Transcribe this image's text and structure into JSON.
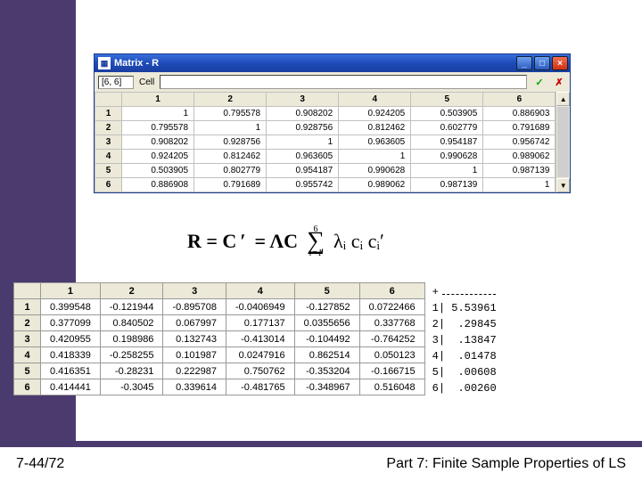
{
  "window": {
    "title": "Matrix - R",
    "cell_ref": "[6, 6]",
    "cell_label": "Cell"
  },
  "grid": {
    "col_headers": [
      "1",
      "2",
      "3",
      "4",
      "5",
      "6"
    ],
    "row_headers": [
      "1",
      "2",
      "3",
      "4",
      "5",
      "6"
    ],
    "cells": [
      [
        "1",
        "0.795578",
        "0.908202",
        "0.924205",
        "0.503905",
        "0.886903"
      ],
      [
        "0.795578",
        "1",
        "0.928756",
        "0.812462",
        "0.602779",
        "0.791689"
      ],
      [
        "0.908202",
        "0.928756",
        "1",
        "0.963605",
        "0.954187",
        "0.956742"
      ],
      [
        "0.924205",
        "0.812462",
        "0.963605",
        "1",
        "0.990628",
        "0.989062"
      ],
      [
        "0.503905",
        "0.802779",
        "0.954187",
        "0.990628",
        "1",
        "0.987139"
      ],
      [
        "0.886908",
        "0.791689",
        "0.955742",
        "0.989062",
        "0.987139",
        "1"
      ]
    ]
  },
  "equation": {
    "lhs": "R = C",
    "prime1": "ʹ",
    "eq": "= ΛC",
    "sum_upper": "6",
    "sum_lower": "i=1",
    "term": "λᵢ cᵢ cᵢʹ"
  },
  "table2": {
    "col_headers": [
      "1",
      "2",
      "3",
      "4",
      "5",
      "6"
    ],
    "row_headers": [
      "1",
      "2",
      "3",
      "4",
      "5",
      "6"
    ],
    "cells": [
      [
        "0.399548",
        "-0.121944",
        "-0.895708",
        "-0.0406949",
        "-0.127852",
        "0.0722466"
      ],
      [
        "0.377099",
        "0.840502",
        "0.067997",
        "0.177137",
        "0.0355656",
        "0.337768"
      ],
      [
        "0.420955",
        "0.198986",
        "0.132743",
        "-0.413014",
        "-0.104492",
        "-0.764252"
      ],
      [
        "0.418339",
        "-0.258255",
        "0.101987",
        "0.0247916",
        "0.862514",
        "0.050123"
      ],
      [
        "0.416351",
        "-0.28231",
        "0.222987",
        "0.750762",
        "-0.353204",
        "-0.166715"
      ],
      [
        "0.414441",
        "-0.3045",
        "0.339614",
        "-0.481765",
        "-0.348967",
        "0.516048"
      ]
    ]
  },
  "eigen": {
    "rows": [
      {
        "i": "1",
        "v": "5.53961"
      },
      {
        "i": "2",
        "v": ".29845"
      },
      {
        "i": "3",
        "v": ".13847"
      },
      {
        "i": "4",
        "v": ".01478"
      },
      {
        "i": "5",
        "v": ".00608"
      },
      {
        "i": "6",
        "v": ".00260"
      }
    ]
  },
  "footer": {
    "page": "7-44/72",
    "title": "Part 7: Finite Sample Properties of LS"
  }
}
